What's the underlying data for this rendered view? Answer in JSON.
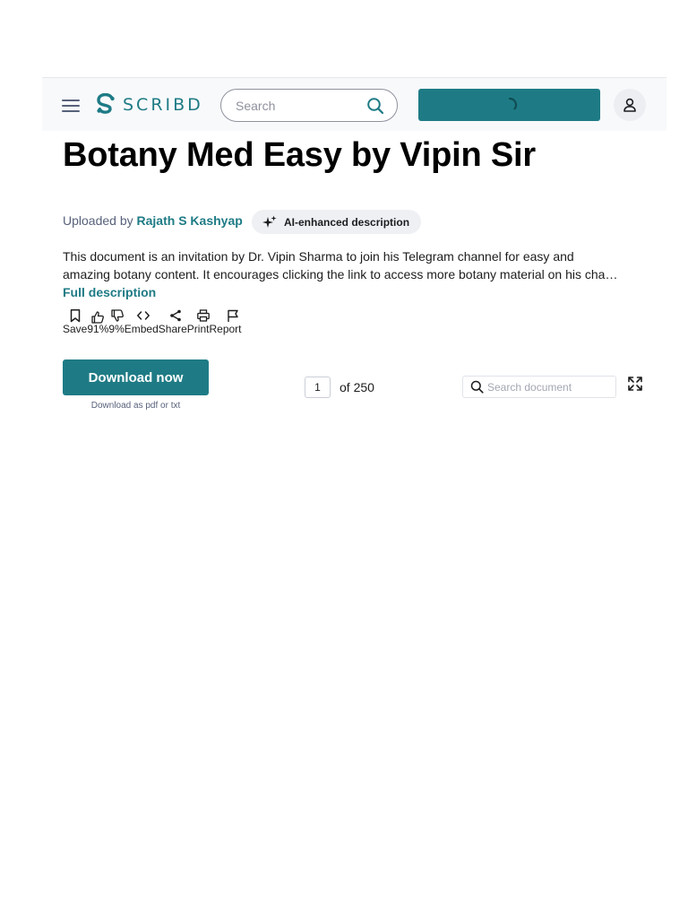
{
  "header": {
    "logo_text": "SCRIBD",
    "search_placeholder": "Search",
    "primary_button_state": "loading",
    "accent_color": "#1e7b85"
  },
  "document": {
    "title": "Botany Med Easy by Vipin Sir",
    "uploaded_prefix": "Uploaded by",
    "uploader": "Rajath S Kashyap",
    "ai_badge": "AI-enhanced description",
    "description": "This document is an invitation by Dr. Vipin Sharma to join his Telegram channel for easy and amazing botany content. It encourages clicking the link to access more botany material on his cha… ",
    "full_description_link": "Full description"
  },
  "actions": [
    {
      "label": "Save",
      "icon": "bookmark-icon"
    },
    {
      "label": "91%",
      "icon": "thumbs-up-icon"
    },
    {
      "label": "9%",
      "icon": "thumbs-down-icon"
    },
    {
      "label": "Embed",
      "icon": "code-icon"
    },
    {
      "label": "Share",
      "icon": "share-icon"
    },
    {
      "label": "Print",
      "icon": "print-icon"
    },
    {
      "label": "Report",
      "icon": "flag-icon"
    }
  ],
  "download": {
    "button_label": "Download now",
    "subtext": "Download as pdf or txt"
  },
  "pager": {
    "current_page": "1",
    "of_text": "of 250"
  },
  "doc_search": {
    "placeholder": "Search document"
  }
}
